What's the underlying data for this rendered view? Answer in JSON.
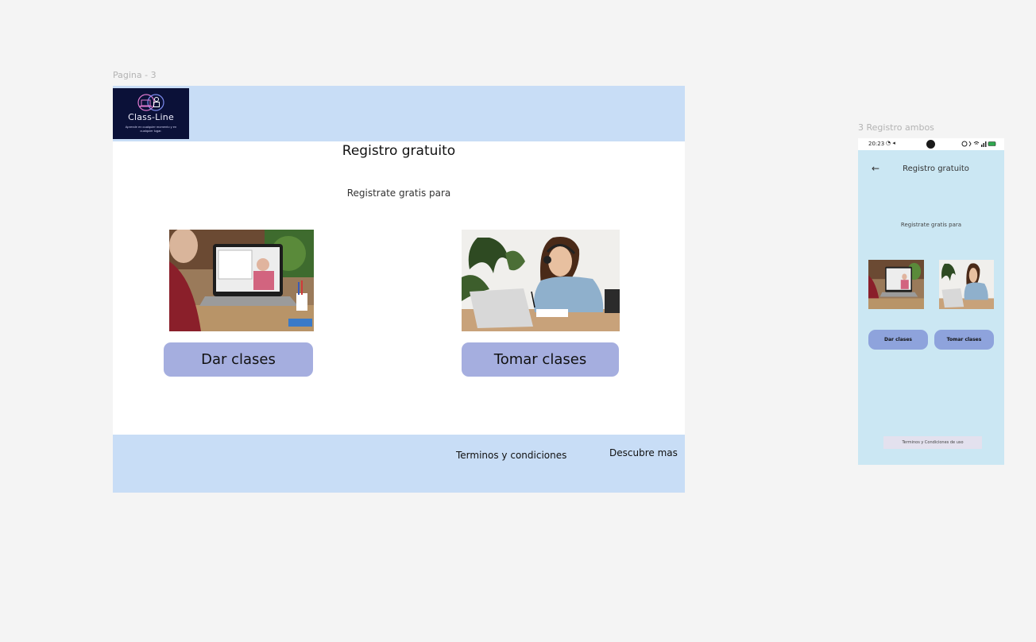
{
  "canvas": {
    "frame_desktop_label": "Pagina - 3",
    "frame_mobile_label": "3 Registro ambos"
  },
  "desktop": {
    "logo": {
      "name": "Class-Line",
      "tagline": "Aprende en cualquier momento y en cualquier lugar."
    },
    "title": "Registro gratuito",
    "subtitle": "Registrate gratis para",
    "options": [
      {
        "image": "teacher-laptop-photo",
        "button": "Dar clases"
      },
      {
        "image": "student-headset-photo",
        "button": "Tomar clases"
      }
    ],
    "footer": {
      "terms": "Terminos y condiciones",
      "discover": "Descubre mas"
    }
  },
  "mobile": {
    "status_bar": {
      "time": "20:23"
    },
    "back_icon": "arrow-left-icon",
    "title": "Registro gratuito",
    "subtitle": "Registrate gratis para",
    "buttons": [
      "Dar clases",
      "Tomar clases"
    ],
    "terms": "Terminos y Condiciones de uso"
  },
  "colors": {
    "header_band": "#c8ddf6",
    "button": "#a5aedf",
    "mobile_bg": "#cbe7f3",
    "mobile_button": "#8ea3dc",
    "logo_bg": "#0b1138"
  }
}
